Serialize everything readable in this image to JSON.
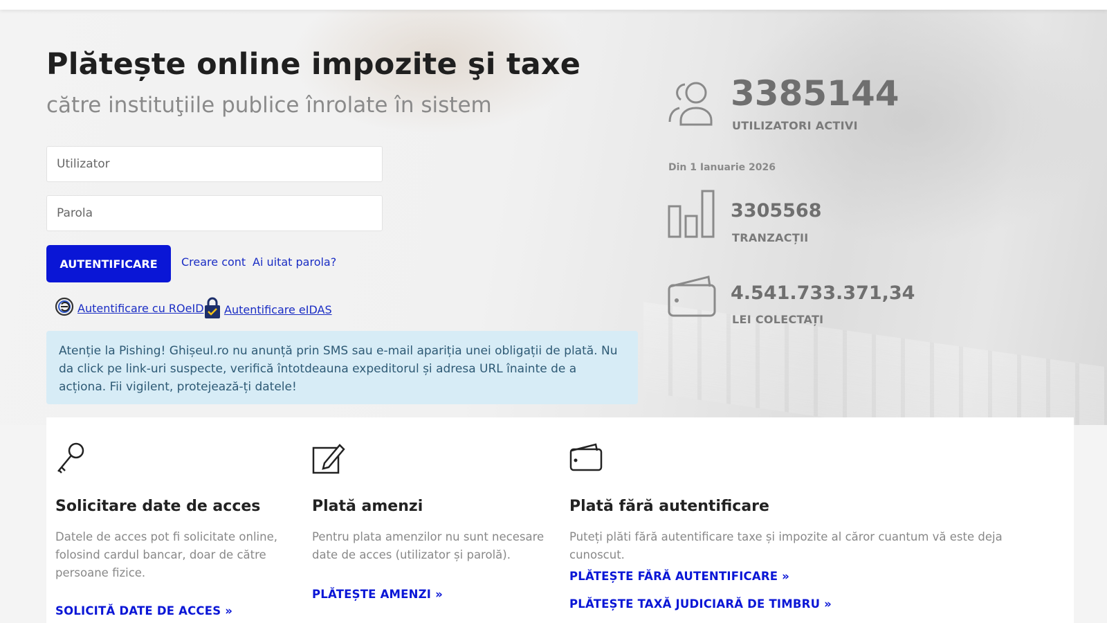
{
  "hero": {
    "title": "Plătește online impozite şi taxe",
    "subtitle": "către instituţiile publice înrolate în sistem"
  },
  "login": {
    "username_placeholder": "Utilizator",
    "password_placeholder": "Parola",
    "submit_label": "AUTENTIFICARE",
    "create_account": "Creare cont",
    "forgot_password": "Ai uitat parola?",
    "roeid_label": "Autentificare cu ROeID",
    "eidas_label": "Autentificare eIDAS"
  },
  "alert": {
    "text": "Atenție la Pishing! Ghișeul.ro nu anunță prin SMS sau e-mail apariția unei obligații de plată. Nu da click pe link-uri suspecte, verifică întotdeauna expeditorul și adresa URL înainte de a acționa. Fii vigilent, protejează-ți datele!"
  },
  "stats": {
    "active_users_value": "3385144",
    "active_users_label": "UTILIZATORI ACTIVI",
    "since": "Din 1 Ianuarie 2026",
    "transactions_value": "3305568",
    "transactions_label": "TRANZACȚII",
    "collected_value": "4.541.733.371,34",
    "collected_label": "LEI COLECTAȚI"
  },
  "cards": [
    {
      "icon": "key-icon",
      "title": "Solicitare date de acces",
      "text": "Datele de acces pot fi solicitate online, folosind cardul bancar, doar de către persoane fizice.",
      "links": [
        "SOLICITĂ DATE DE ACCES »"
      ]
    },
    {
      "icon": "edit-icon",
      "title": "Plată amenzi",
      "text": "Pentru plata amenzilor nu sunt necesare date de acces (utilizator și parolă).",
      "links": [
        "PLĂTEȘTE AMENZI »"
      ]
    },
    {
      "icon": "wallet-icon",
      "title": "Plată fără autentificare",
      "text": "Puteți plăti fără autentificare taxe și impozite al căror cuantum vă este deja cunoscut.",
      "links": [
        "PLĂTEȘTE FĂRĂ AUTENTIFICARE »",
        "PLĂTEȘTE TAXĂ JUDICIARĂ DE TIMBRU »"
      ]
    }
  ],
  "colors": {
    "primary_button": "#0a16d6",
    "link": "#1a2dc4",
    "alert_bg": "#d7ecf6",
    "alert_text": "#2e5a75",
    "stats_text": "#6f6f6f"
  }
}
